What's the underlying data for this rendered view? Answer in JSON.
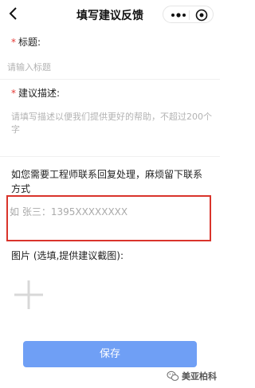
{
  "navbar": {
    "title": "填写建议反馈",
    "back_icon": "chevron-left-icon",
    "more_icon": "more-dots-icon",
    "close_icon": "target-circle-icon"
  },
  "form": {
    "title_label": "标题:",
    "title_placeholder": "请输入标题",
    "desc_label": "建议描述:",
    "desc_placeholder": "请填写描述以便我们提供更好的帮助，不超过200个字",
    "contact_note": "如您需要工程师联系回复处理，麻烦留下联系方式",
    "contact_placeholder": "如 张三：1395XXXXXXXX",
    "image_label": "图片 (选填,提供建议截图):",
    "add_image_icon": "plus-icon",
    "save_label": "保存",
    "required_mark": "*"
  },
  "watermark": {
    "text": "美亚柏科",
    "icon": "wechat-icon"
  },
  "colors": {
    "accent": "#6f9ff5",
    "required": "#e53935",
    "highlight": "#d9342b"
  }
}
